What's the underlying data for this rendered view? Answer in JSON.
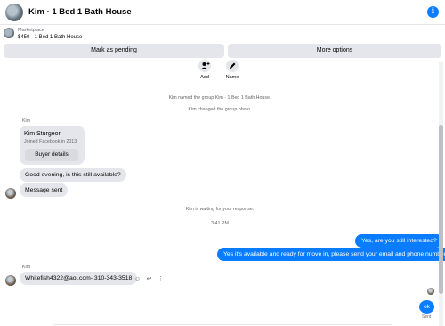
{
  "header": {
    "title": "Kim · 1 Bed 1 Bath House",
    "info_icon": "info-icon"
  },
  "listing": {
    "category": "Marketplace",
    "summary": "$450 · 1 Bed 1 Bath House"
  },
  "buttons": {
    "mark_pending": "Mark as pending",
    "more_options": "More options"
  },
  "actions": {
    "add_label": "Add",
    "name_label": "Name"
  },
  "system": {
    "named_group": "Kim named the group Kim · 1 Bed 1 Bath House.",
    "changed_photo": "Kim changed the group photo.",
    "waiting": "Kim is waiting for your response.",
    "time": "3:41 PM"
  },
  "buyer": {
    "sender": "Kim",
    "name": "Kim Sturgeon",
    "joined": "Joined Facebook in 2013",
    "details_button": "Buyer details",
    "msg1": "Good evening, is this still available?",
    "msg2": "Message sent"
  },
  "outgoing": {
    "msg1": "Yes, are you still interested?",
    "msg2": "Yes it's available and ready for move in, please send your email and phone number",
    "ok": "ok",
    "sent_label": "Sent"
  },
  "reply": {
    "sender": "Kim",
    "msg": "Whitefish4322@aol.com- 310-343-3518"
  },
  "colors": {
    "accent": "#0a7cff",
    "bubble_in": "#e4e6eb",
    "muted": "#65676b"
  }
}
